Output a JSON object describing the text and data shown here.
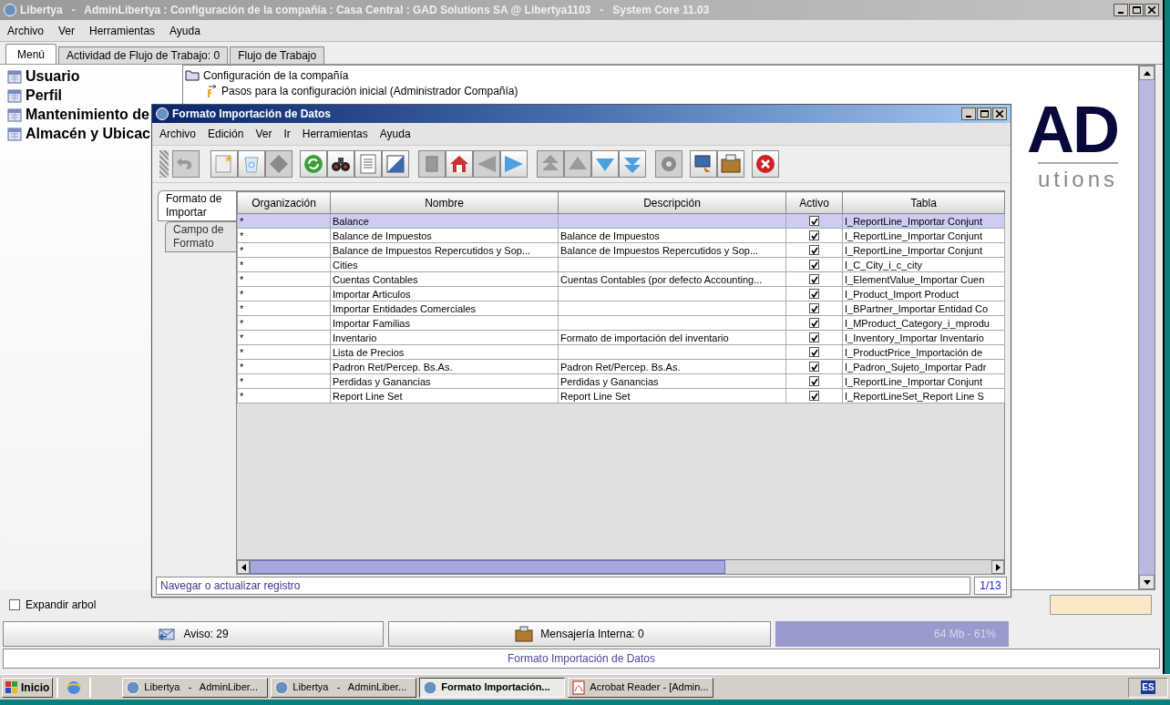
{
  "window": {
    "title": "Libertya   -   AdminLibertya : Configuración de la compañía : Casa Central : GAD Solutions SA @ Libertya1103   -   System Core 11.03"
  },
  "menu": [
    "Archivo",
    "Ver",
    "Herramientas",
    "Ayuda"
  ],
  "tabs": [
    {
      "label": "Menú",
      "selected": true
    },
    {
      "label": "Actividad de Flujo de Trabajo: 0",
      "selected": false
    },
    {
      "label": "Flujo de Trabajo",
      "selected": false
    }
  ],
  "favorites": [
    "Usuario",
    "Perfil",
    "Mantenimiento de",
    "Almacén y Ubicac"
  ],
  "tree": [
    {
      "label": "Configuración de la compañía",
      "kind": "folder",
      "children": [
        {
          "label": "Pasos para la configuración inicial (Administrador Compañía)",
          "kind": "workflow"
        }
      ]
    }
  ],
  "logo": {
    "mark": "AD",
    "tagline": "utions"
  },
  "expand_tree": {
    "label": "Expandir arbol",
    "checked": false
  },
  "status": {
    "notices": "Aviso: 29",
    "messages": "Mensajería Interna: 0",
    "memory": "64 Mb - 61%",
    "info": "Formato Importación de Datos"
  },
  "dialog": {
    "title": "Formato Importación de Datos",
    "menu": [
      "Archivo",
      "Edición",
      "Ver",
      "Ir",
      "Herramientas",
      "Ayuda"
    ],
    "side_tabs": [
      {
        "label": "Formato de Importar",
        "selected": true
      },
      {
        "label": "Campo de Formato",
        "selected": false
      }
    ],
    "table": {
      "columns": [
        "Organización",
        "Nombre",
        "Descripción",
        "Activo",
        "Tabla"
      ],
      "rows": [
        {
          "org": "*",
          "name": "Balance",
          "description": "",
          "active": true,
          "table": "I_ReportLine_Importar Conjunt",
          "selected": true
        },
        {
          "org": "*",
          "name": "Balance de Impuestos",
          "description": "Balance de Impuestos",
          "active": true,
          "table": "I_ReportLine_Importar Conjunt",
          "selected": false
        },
        {
          "org": "*",
          "name": "Balance de Impuestos Repercutidos y Sop...",
          "description": "Balance de Impuestos Repercutidos y Sop...",
          "active": true,
          "table": "I_ReportLine_Importar Conjunt",
          "selected": false
        },
        {
          "org": "*",
          "name": "Cities",
          "description": "",
          "active": true,
          "table": "I_C_City_i_c_city",
          "selected": false
        },
        {
          "org": "*",
          "name": "Cuentas Contables",
          "description": "Cuentas Contables (por defecto Accounting...",
          "active": true,
          "table": "I_ElementValue_Importar Cuen",
          "selected": false
        },
        {
          "org": "*",
          "name": "Importar Articulos",
          "description": "",
          "active": true,
          "table": "I_Product_Import Product",
          "selected": false
        },
        {
          "org": "*",
          "name": "Importar Entidades Comerciales",
          "description": "",
          "active": true,
          "table": "I_BPartner_Importar Entidad Co",
          "selected": false
        },
        {
          "org": "*",
          "name": "Importar Familias",
          "description": "",
          "active": true,
          "table": "I_MProduct_Category_i_mprodu",
          "selected": false
        },
        {
          "org": "*",
          "name": "Inventario",
          "description": "Formato de importación del inventario",
          "active": true,
          "table": "I_Inventory_Importar Inventario",
          "selected": false
        },
        {
          "org": "*",
          "name": "Lista de Precios",
          "description": "",
          "active": true,
          "table": "I_ProductPrice_Importación de",
          "selected": false
        },
        {
          "org": "*",
          "name": "Padron Ret/Percep. Bs.As.",
          "description": "Padron Ret/Percep. Bs.As.",
          "active": true,
          "table": "I_Padron_Sujeto_Importar Padr",
          "selected": false
        },
        {
          "org": "*",
          "name": "Perdidas y Ganancias",
          "description": "Perdidas y Ganancias",
          "active": true,
          "table": "I_ReportLine_Importar Conjunt",
          "selected": false
        },
        {
          "org": "*",
          "name": "Report Line Set",
          "description": "Report Line Set",
          "active": true,
          "table": "I_ReportLineSet_Report Line S",
          "selected": false
        }
      ]
    },
    "status": "Navegar o actualizar registro",
    "record": "1/13"
  },
  "taskbar": {
    "start": "Inicio",
    "items": [
      {
        "label": "Libertya   -   AdminLiber...",
        "selected": false
      },
      {
        "label": "Libertya   -   AdminLiber...",
        "selected": false
      },
      {
        "label": "Formato Importación...",
        "selected": true
      },
      {
        "label": "Acrobat Reader - [Admin...",
        "selected": false
      }
    ],
    "tray": "ES"
  }
}
